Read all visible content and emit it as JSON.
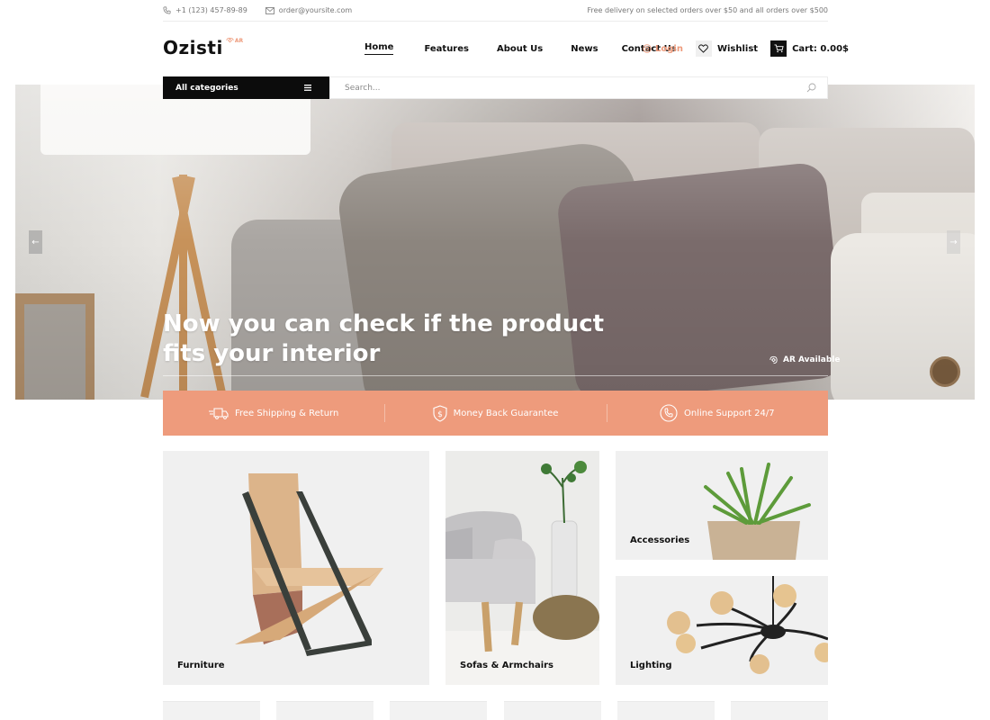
{
  "topbar": {
    "phone": "+1 (123) 457-89-89",
    "email": "order@yoursite.com",
    "promo": "Free delivery on selected orders over $50 and all orders over $500"
  },
  "header": {
    "logo": "Ozisti",
    "logo_badge": "AR",
    "nav": [
      {
        "label": "Home",
        "active": true
      },
      {
        "label": "Features",
        "active": false
      },
      {
        "label": "About Us",
        "active": false
      },
      {
        "label": "News",
        "active": false
      },
      {
        "label": "Contact Us",
        "active": false
      }
    ],
    "login": "Login",
    "wishlist": "Wishlist",
    "cart": "Cart: 0.00$"
  },
  "search": {
    "categories_label": "All categories",
    "placeholder": "Search..."
  },
  "hero": {
    "title_line1": "Now you can check if the product",
    "title_line2": "fits your interior",
    "ar_label": "AR Available",
    "prev_icon": "arrow-left-icon",
    "next_icon": "arrow-right-icon"
  },
  "features": [
    {
      "icon": "truck-icon",
      "label": "Free Shipping & Return"
    },
    {
      "icon": "shield-dollar-icon",
      "label": "Money Back Guarantee"
    },
    {
      "icon": "phone-icon",
      "label": "Online Support 24/7"
    }
  ],
  "categories": [
    {
      "label": "Furniture"
    },
    {
      "label": "Sofas & Armchairs"
    },
    {
      "label": "Accessories"
    },
    {
      "label": "Lighting"
    }
  ],
  "colors": {
    "accent": "#ee9b7c",
    "dark": "#0c0c0c",
    "tile_bg": "#f2f2f2"
  }
}
